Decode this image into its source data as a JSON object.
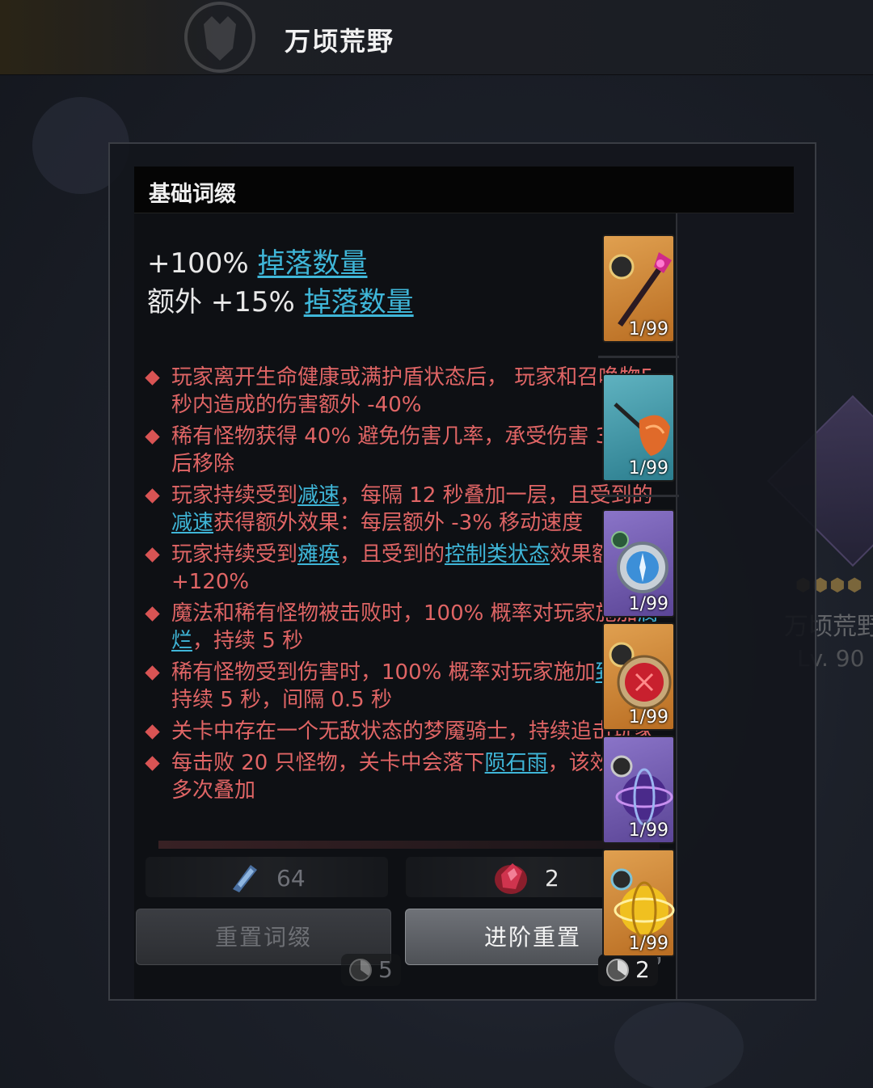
{
  "header": {
    "zone_title": "万顷荒野"
  },
  "side_card": {
    "name": "万顷荒野",
    "level": "Lv. 90"
  },
  "panel": {
    "section_title": "基础词缀",
    "main_affixes": [
      {
        "prefix": "+100% ",
        "keyword": "掉落数量"
      },
      {
        "prefix": "额外 +15% ",
        "keyword": "掉落数量"
      }
    ],
    "affixes": [
      {
        "parts": [
          [
            "t",
            "玩家离开生命健康或满护盾状态后， 玩家和召唤物5 秒内造成的伤害额外 -40%"
          ]
        ]
      },
      {
        "parts": [
          [
            "t",
            "稀有怪物获得 40% 避免伤害几率，承受伤害 30 次后移除"
          ]
        ]
      },
      {
        "parts": [
          [
            "t",
            "玩家持续受到"
          ],
          [
            "l",
            "减速"
          ],
          [
            "t",
            "，每隔 12 秒叠加一层，且受到的"
          ],
          [
            "l",
            "减速"
          ],
          [
            "t",
            "获得额外效果：每层额外 -3% 移动速度"
          ]
        ]
      },
      {
        "parts": [
          [
            "t",
            "玩家持续受到"
          ],
          [
            "l",
            "瘫痪"
          ],
          [
            "t",
            "，且受到的"
          ],
          [
            "l",
            "控制类状态"
          ],
          [
            "t",
            "效果额外 +120%"
          ]
        ]
      },
      {
        "parts": [
          [
            "t",
            "魔法和稀有怪物被击败时，100% 概率对玩家施加"
          ],
          [
            "l",
            "腐烂"
          ],
          [
            "t",
            "，持续 5 秒"
          ]
        ]
      },
      {
        "parts": [
          [
            "t",
            "稀有怪物受到伤害时，100% 概率对玩家施加"
          ],
          [
            "l",
            "致残"
          ],
          [
            "t",
            "，持续 5 秒，间隔 0.5 秒"
          ]
        ]
      },
      {
        "parts": [
          [
            "t",
            "关卡中存在一个无敌状态的梦魇骑士，持续追击玩家"
          ]
        ]
      },
      {
        "parts": [
          [
            "t",
            "每击败 20 只怪物，关卡中会落下"
          ],
          [
            "l",
            "陨石雨"
          ],
          [
            "t",
            "，该效果可多次叠加"
          ]
        ]
      }
    ],
    "cost_left": "64",
    "cost_right": "2",
    "reset_button": "重置词缀",
    "advanced_reset_button": "进阶重置",
    "reset_ticks": "5",
    "advanced_ticks": "2"
  },
  "items": [
    {
      "rarity": "orange",
      "count": "1/99",
      "icon": "staff-icon"
    },
    {
      "rarity": "teal",
      "count": "1/99",
      "icon": "feather-icon"
    },
    {
      "rarity": "purple",
      "count": "1/99",
      "icon": "compass-icon"
    },
    {
      "rarity": "orange",
      "count": "1/99",
      "icon": "red-orb-icon"
    },
    {
      "rarity": "purple",
      "count": "1/99",
      "icon": "sphere-icon"
    },
    {
      "rarity": "orange",
      "count": "1/99",
      "icon": "gold-sphere-icon"
    }
  ],
  "colors": {
    "affix_red": "#e06565",
    "keyword_blue": "#3fb6d8"
  }
}
